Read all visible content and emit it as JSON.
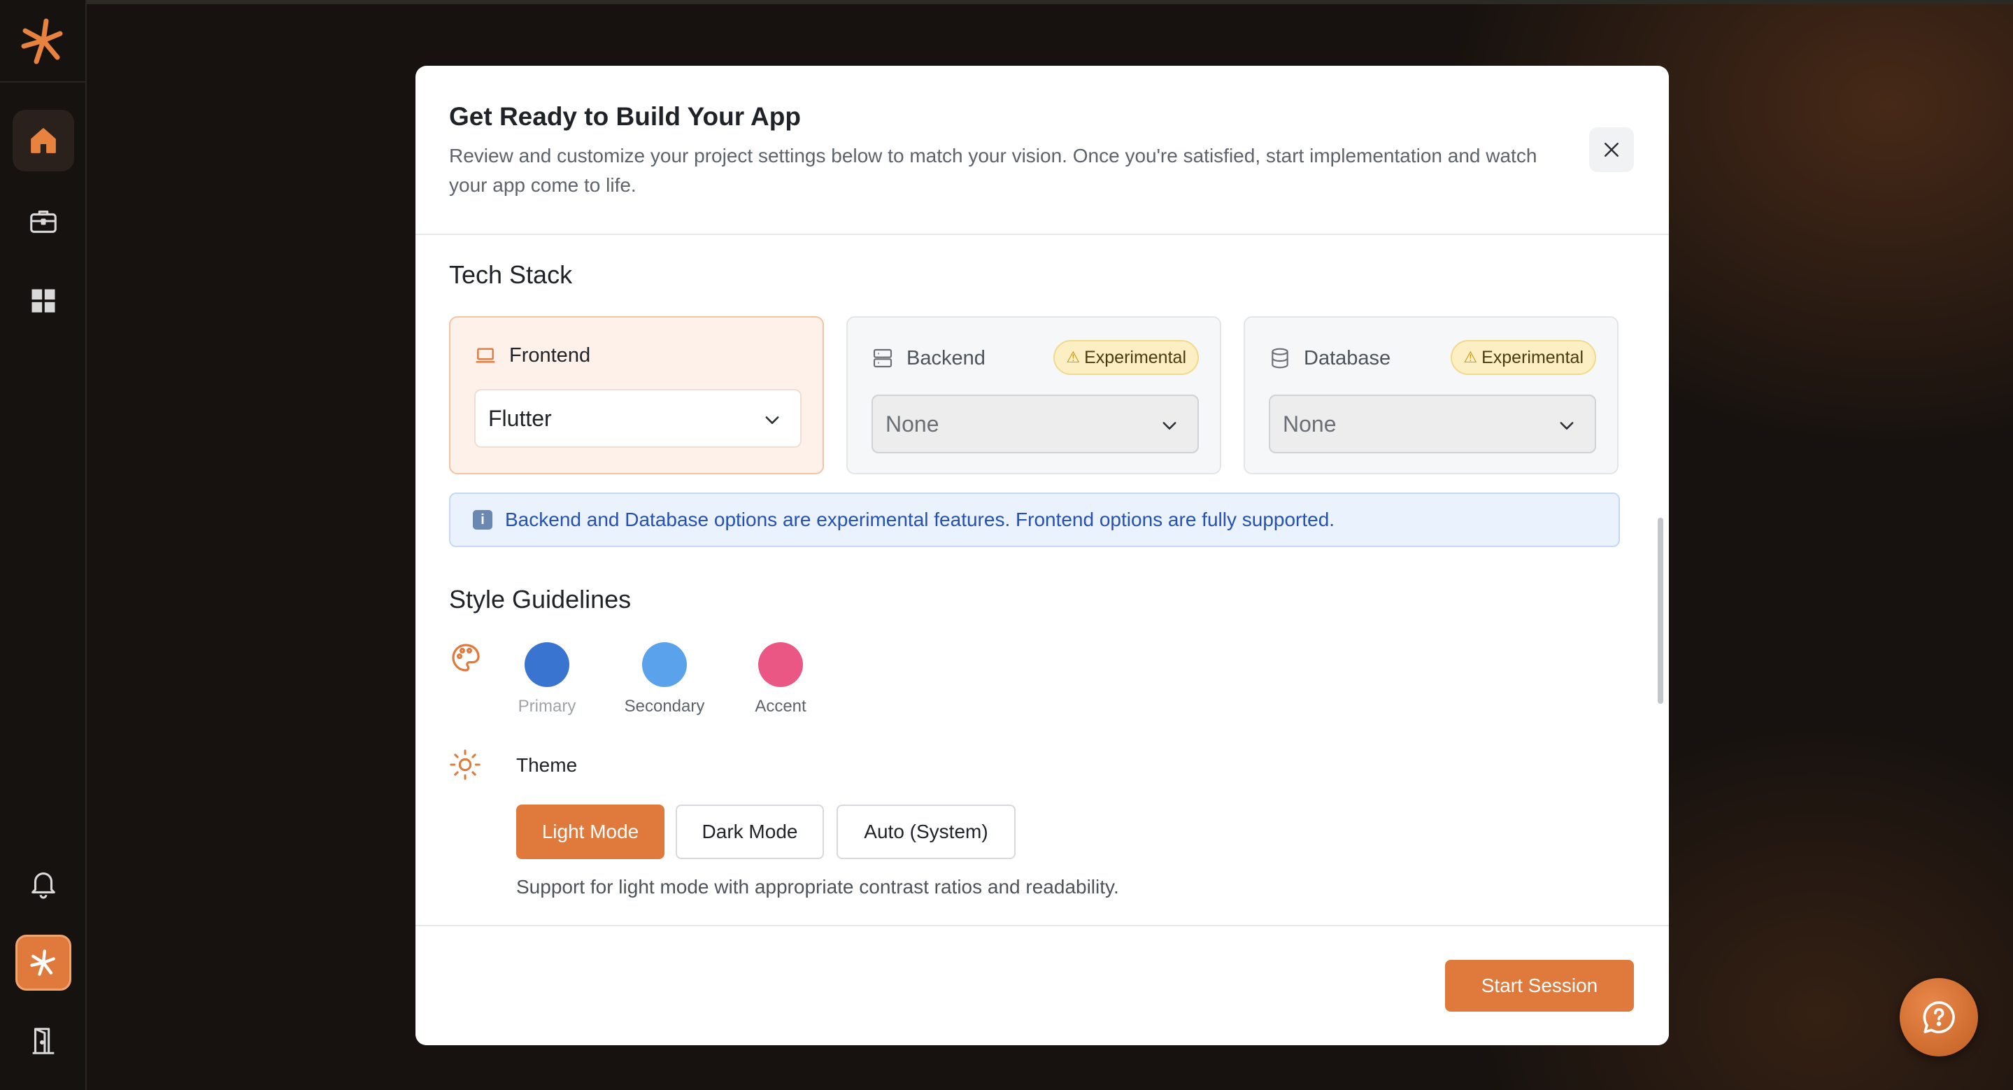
{
  "colors": {
    "accent": "#e07a3c",
    "primary": "#3a74d1",
    "secondary": "#5aa2ec",
    "accent_swatch": "#ea5784"
  },
  "sidebar": {
    "items": [
      {
        "icon": "home-icon",
        "active": true
      },
      {
        "icon": "briefcase-icon",
        "active": false
      },
      {
        "icon": "grid-icon",
        "active": false
      }
    ],
    "bottom": [
      {
        "icon": "bell-icon"
      },
      {
        "icon": "brand-asterisk-icon"
      },
      {
        "icon": "exit-door-icon"
      }
    ]
  },
  "modal": {
    "title": "Get Ready to Build Your App",
    "description": "Review and customize your project settings below to match your vision. Once you're satisfied, start implementation and watch your app come to life.",
    "tech_stack": {
      "title": "Tech Stack",
      "frontend": {
        "label": "Frontend",
        "value": "Flutter"
      },
      "backend": {
        "label": "Backend",
        "badge": "Experimental",
        "value": "None"
      },
      "database": {
        "label": "Database",
        "badge": "Experimental",
        "value": "None"
      },
      "info": "Backend and Database options are experimental features. Frontend options are fully supported."
    },
    "style": {
      "title": "Style Guidelines",
      "swatches": [
        {
          "label": "Primary",
          "color": "#3a74d1"
        },
        {
          "label": "Secondary",
          "color": "#5aa2ec"
        },
        {
          "label": "Accent",
          "color": "#ea5784"
        }
      ],
      "theme_label": "Theme",
      "theme_options": [
        "Light Mode",
        "Dark Mode",
        "Auto (System)"
      ],
      "selected_theme": "Light Mode",
      "theme_description": "Support for light mode with appropriate contrast ratios and readability."
    },
    "start_button": "Start Session"
  }
}
